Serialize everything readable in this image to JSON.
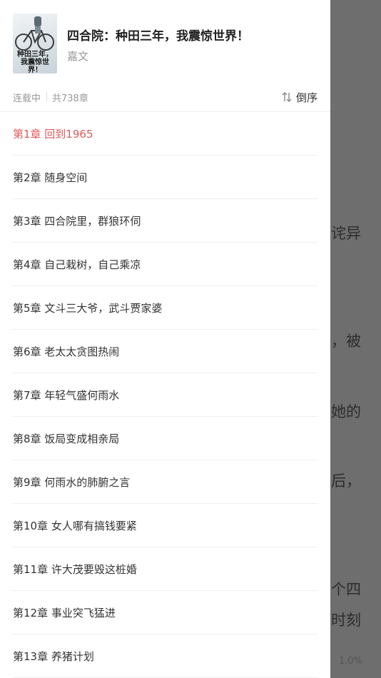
{
  "reader": {
    "fragments": [
      "诧异",
      "，被",
      "她的",
      "之后，",
      "个四",
      "时刻"
    ],
    "progress": "1.0%"
  },
  "book": {
    "cover_text": "种田三年，我震惊世界！",
    "title": "四合院：种田三年，我震惊世界！",
    "author": "嘉文",
    "status": "连载中",
    "chapter_count": "共738章"
  },
  "sort": {
    "label": "倒序",
    "icon": "sort-order-icon"
  },
  "chapters": [
    {
      "label": "第1章 回到1965",
      "active": true
    },
    {
      "label": "第2章 随身空间"
    },
    {
      "label": "第3章 四合院里，群狼环伺"
    },
    {
      "label": "第4章 自己栽树，自己乘凉"
    },
    {
      "label": "第5章 文斗三大爷，武斗贾家婆"
    },
    {
      "label": "第6章 老太太贪图热闹"
    },
    {
      "label": "第7章 年轻气盛何雨水"
    },
    {
      "label": "第8章 饭局变成相亲局"
    },
    {
      "label": "第9章 何雨水的肺腑之言"
    },
    {
      "label": "第10章 女人哪有搞钱要紧"
    },
    {
      "label": "第11章 许大茂要毁这桩婚"
    },
    {
      "label": "第12章 事业突飞猛进"
    },
    {
      "label": "第13章 养猪计划"
    }
  ],
  "colors": {
    "active": "#e05a5a",
    "overlay": "#6e6e6e"
  }
}
